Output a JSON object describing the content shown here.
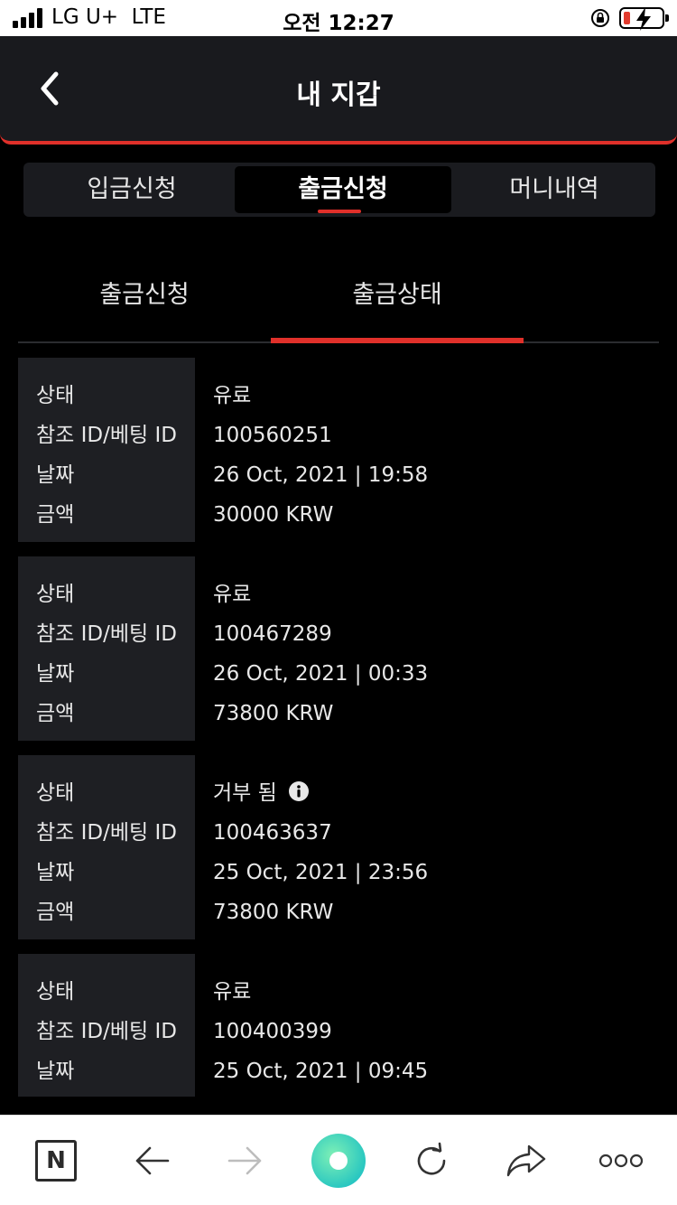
{
  "status_bar": {
    "carrier": "LG U+  LTE",
    "time": "오전 12:27"
  },
  "header": {
    "title": "내 지갑"
  },
  "top_tabs": [
    {
      "label": "입금신청"
    },
    {
      "label": "출금신청"
    },
    {
      "label": "머니내역"
    }
  ],
  "sub_tabs": [
    {
      "label": "출금신청"
    },
    {
      "label": "출금상태"
    }
  ],
  "records": [
    {
      "status_label": "상태",
      "status": "유료",
      "ref_label": "참조 ID/베팅 ID",
      "ref": "100560251",
      "date_label": "날짜",
      "date": "26 Oct, 2021 | 19:58",
      "amount_label": "금액",
      "amount": "30000 KRW"
    },
    {
      "status_label": "상태",
      "status": "유료",
      "ref_label": "참조 ID/베팅 ID",
      "ref": "100467289",
      "date_label": "날짜",
      "date": "26 Oct, 2021 | 00:33",
      "amount_label": "금액",
      "amount": "73800 KRW"
    },
    {
      "status_label": "상태",
      "status": "거부 됨",
      "ref_label": "참조 ID/베팅 ID",
      "ref": "100463637",
      "date_label": "날짜",
      "date": "25 Oct, 2021 | 23:56",
      "amount_label": "금액",
      "amount": "73800 KRW"
    },
    {
      "status_label": "상태",
      "status": "유료",
      "ref_label": "참조 ID/베팅 ID",
      "ref": "100400399",
      "date_label": "날짜",
      "date": "25 Oct, 2021 | 09:45"
    }
  ],
  "toolbar": {
    "n_logo": "N"
  },
  "colors": {
    "accent": "#e0302a",
    "header_bg": "#191a1e",
    "label_cell_bg": "#1e1f23"
  }
}
